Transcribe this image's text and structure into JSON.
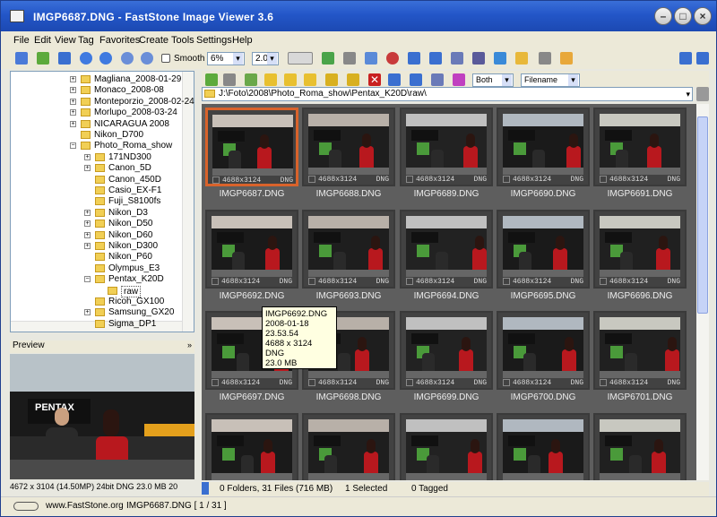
{
  "window": {
    "title": "IMGP6687.DNG  -  FastStone Image Viewer 3.6"
  },
  "menu": [
    "File",
    "Edit",
    "View",
    "Tag",
    "Favorites",
    "Create",
    "Tools",
    "Settings",
    "Help"
  ],
  "toolbar": {
    "smooth_label": "Smooth",
    "zoom_value": "6%",
    "ratio_value": "2.0"
  },
  "navbar": {
    "filter_value": "Both",
    "sort_value": "Filename"
  },
  "path": "J:\\Foto\\2008\\Photo_Roma_show\\Pentax_K20D\\raw\\",
  "tree": {
    "items": [
      {
        "label": "Magliana_2008-01-29",
        "level": 1,
        "pm": true
      },
      {
        "label": "Monaco_2008-08",
        "level": 1,
        "pm": true
      },
      {
        "label": "Monteporzio_2008-02-24",
        "level": 1,
        "pm": true
      },
      {
        "label": "Morlupo_2008-03-24",
        "level": 1,
        "pm": true
      },
      {
        "label": "NICARAGUA 2008",
        "level": 1,
        "pm": true
      },
      {
        "label": "Nikon_D700",
        "level": 1,
        "pm": false
      },
      {
        "label": "Photo_Roma_show",
        "level": 1,
        "pm": true,
        "open": true
      },
      {
        "label": "171ND300",
        "level": 2,
        "pm": true
      },
      {
        "label": "Canon_5D",
        "level": 2,
        "pm": true
      },
      {
        "label": "Canon_450D",
        "level": 2,
        "pm": false
      },
      {
        "label": "Casio_EX-F1",
        "level": 2,
        "pm": false
      },
      {
        "label": "Fuji_S8100fs",
        "level": 2,
        "pm": false
      },
      {
        "label": "Nikon_D3",
        "level": 2,
        "pm": true
      },
      {
        "label": "Nikon_D50",
        "level": 2,
        "pm": true
      },
      {
        "label": "Nikon_D60",
        "level": 2,
        "pm": true
      },
      {
        "label": "Nikon_D300",
        "level": 2,
        "pm": true
      },
      {
        "label": "Nikon_P60",
        "level": 2,
        "pm": false
      },
      {
        "label": "Olympus_E3",
        "level": 2,
        "pm": false
      },
      {
        "label": "Pentax_K20D",
        "level": 2,
        "pm": true,
        "open": true
      },
      {
        "label": "raw",
        "level": 3,
        "pm": false,
        "selected": true
      },
      {
        "label": "Ricoh_GX100",
        "level": 2,
        "pm": false
      },
      {
        "label": "Samsung_GX20",
        "level": 2,
        "pm": true
      },
      {
        "label": "Sigma_DP1",
        "level": 2,
        "pm": false
      }
    ]
  },
  "preview": {
    "header": "Preview",
    "info": "4672 x 3104 (14.50MP)    24bit DNG    23.0 MB    20"
  },
  "thumbnails": [
    {
      "name": "IMGP6687.DNG",
      "res": "4688x3124",
      "fmt": "DNG",
      "selected": true
    },
    {
      "name": "IMGP6688.DNG",
      "res": "4688x3124",
      "fmt": "DNG"
    },
    {
      "name": "IMGP6689.DNG",
      "res": "4688x3124",
      "fmt": "DNG"
    },
    {
      "name": "IMGP6690.DNG",
      "res": "4688x3124",
      "fmt": "DNG"
    },
    {
      "name": "IMGP6691.DNG",
      "res": "4688x3124",
      "fmt": "DNG"
    },
    {
      "name": "IMGP6692.DNG",
      "res": "4688x3124",
      "fmt": "DNG"
    },
    {
      "name": "IMGP6693.DNG",
      "res": "4688x3124",
      "fmt": "DNG"
    },
    {
      "name": "IMGP6694.DNG",
      "res": "4688x3124",
      "fmt": "DNG"
    },
    {
      "name": "IMGP6695.DNG",
      "res": "4688x3124",
      "fmt": "DNG"
    },
    {
      "name": "IMGP6696.DNG",
      "res": "4688x3124",
      "fmt": "DNG"
    },
    {
      "name": "IMGP6697.DNG",
      "res": "4688x3124",
      "fmt": "DNG"
    },
    {
      "name": "IMGP6698.DNG",
      "res": "4688x3124",
      "fmt": "DNG"
    },
    {
      "name": "IMGP6699.DNG",
      "res": "4688x3124",
      "fmt": "DNG"
    },
    {
      "name": "IMGP6700.DNG",
      "res": "4688x3124",
      "fmt": "DNG"
    },
    {
      "name": "IMGP6701.DNG",
      "res": "4688x3124",
      "fmt": "DNG"
    },
    {
      "name": "",
      "res": "",
      "fmt": ""
    },
    {
      "name": "",
      "res": "",
      "fmt": ""
    },
    {
      "name": "",
      "res": "",
      "fmt": ""
    },
    {
      "name": "",
      "res": "",
      "fmt": ""
    },
    {
      "name": "",
      "res": "",
      "fmt": ""
    }
  ],
  "tooltip": {
    "lines": [
      "IMGP6692.DNG",
      "2008-01-18 23.53.54",
      "4688 x 3124  DNG",
      "23.0 MB"
    ]
  },
  "status": {
    "folders": "0 Folders, 31 Files (716 MB)",
    "selected": "1 Selected",
    "tagged": "0 Tagged"
  },
  "bottom": {
    "site": "www.FastStone.org",
    "file": "IMGP6687.DNG [ 1 / 31 ]"
  },
  "colors": {
    "title_bar": "#2356c8",
    "selection": "#d9632b",
    "thumb_bg": "#5e5e5e"
  }
}
